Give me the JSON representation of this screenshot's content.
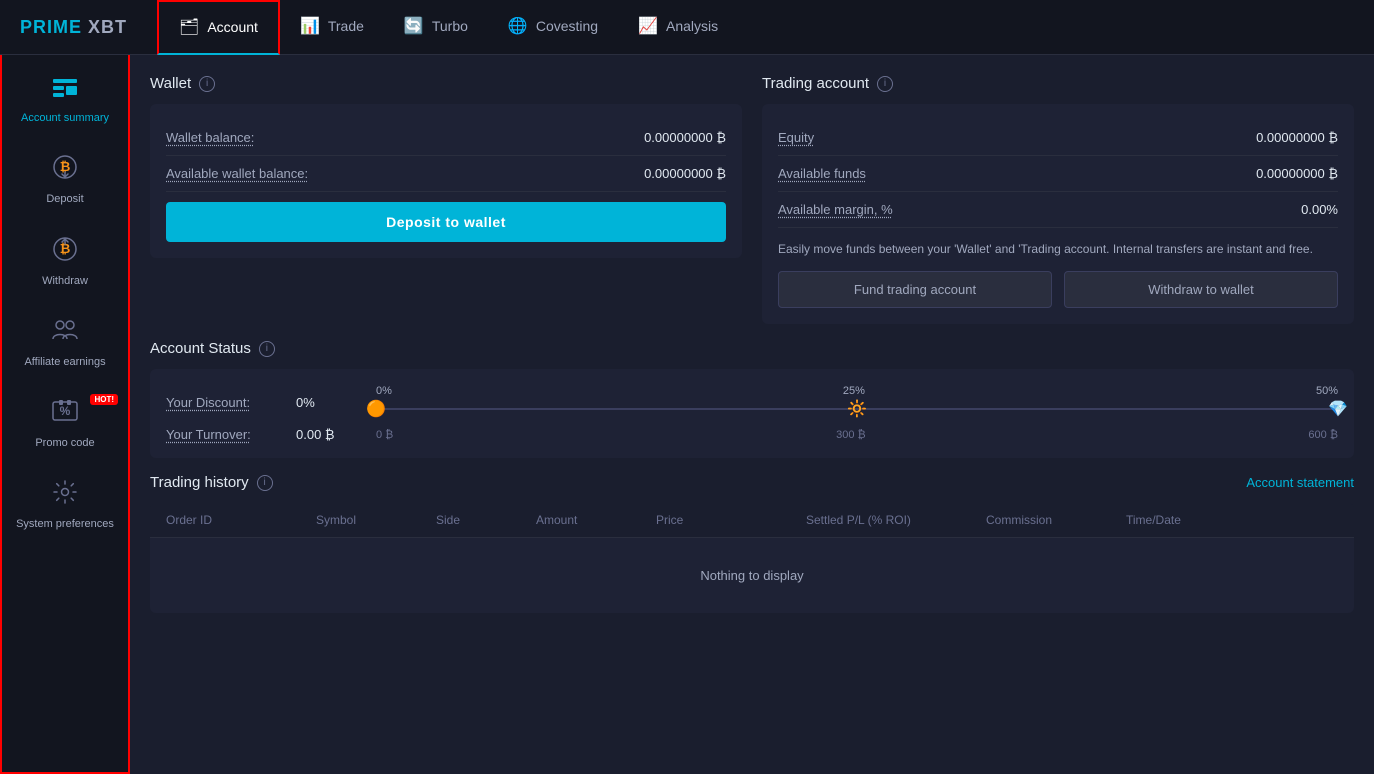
{
  "logo": {
    "text_prime": "PRIME",
    "text_xbt": " XBT"
  },
  "nav": {
    "items": [
      {
        "label": "Account",
        "icon": "🗂",
        "active": true
      },
      {
        "label": "Trade",
        "icon": "📊",
        "active": false
      },
      {
        "label": "Turbo",
        "icon": "🔄",
        "active": false
      },
      {
        "label": "Covesting",
        "icon": "🌐",
        "active": false
      },
      {
        "label": "Analysis",
        "icon": "📈",
        "active": false
      }
    ]
  },
  "sidebar": {
    "items": [
      {
        "label": "Account summary",
        "icon": "📋",
        "active": true
      },
      {
        "label": "Deposit",
        "icon": "₿↓",
        "active": false
      },
      {
        "label": "Withdraw",
        "icon": "₿↑",
        "active": false
      },
      {
        "label": "Affiliate earnings",
        "icon": "👥",
        "active": false
      },
      {
        "label": "Promo code",
        "icon": "%",
        "active": false,
        "hot": true
      },
      {
        "label": "System preferences",
        "icon": "⚙",
        "active": false
      }
    ]
  },
  "wallet": {
    "section_title": "Wallet",
    "info_icon": "i",
    "balance_label": "Wallet balance:",
    "balance_value": "0.00000000 ₿",
    "available_label": "Available wallet balance:",
    "available_value": "0.00000000 ₿",
    "deposit_button": "Deposit to wallet"
  },
  "account_status": {
    "section_title": "Account Status",
    "info_icon": "i",
    "discount_label": "Your Discount:",
    "discount_value": "0%",
    "turnover_label": "Your Turnover:",
    "turnover_value": "0.00 ₿",
    "tiers": [
      {
        "pct": "0%",
        "amount": "0 ₿",
        "icon": "🟠"
      },
      {
        "pct": "25%",
        "amount": "300 ₿",
        "icon": "🔆"
      },
      {
        "pct": "50%",
        "amount": "600 ₿",
        "icon": "💎"
      }
    ]
  },
  "trading_account": {
    "section_title": "Trading account",
    "info_icon": "i",
    "equity_label": "Equity",
    "equity_value": "0.00000000 ₿",
    "available_funds_label": "Available funds",
    "available_funds_value": "0.00000000 ₿",
    "margin_label": "Available margin, %",
    "margin_value": "0.00%",
    "info_text": "Easily move funds between your 'Wallet' and 'Trading account. Internal transfers are instant and free.",
    "fund_button": "Fund trading account",
    "withdraw_button": "Withdraw to wallet"
  },
  "trading_history": {
    "section_title": "Trading history",
    "info_icon": "i",
    "account_statement_link": "Account statement",
    "columns": [
      "Order ID",
      "Symbol",
      "Side",
      "Amount",
      "Price",
      "Settled P/L (% ROI)",
      "Commission",
      "Time/Date"
    ],
    "empty_message": "Nothing to display"
  }
}
